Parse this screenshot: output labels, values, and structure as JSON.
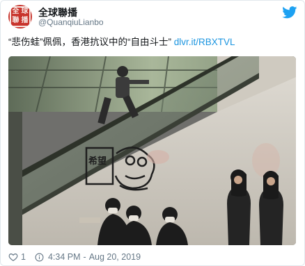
{
  "account": {
    "display_name": "全球聯播",
    "handle": "@QuanqiuLianbo",
    "avatar_seal": [
      "全",
      "球",
      "聯",
      "播"
    ]
  },
  "tweet": {
    "text": "“悲伤蛙”佩佩，香港抗议中的“自由斗士”",
    "link": "dlvr.it/RBXTVL"
  },
  "photo": {
    "sign_text": "希望",
    "description_icon": "photo"
  },
  "footer": {
    "likes": "1",
    "time": "4:34 PM",
    "separator": "-",
    "date": "Aug 20, 2019"
  },
  "colors": {
    "link": "#1b95e0",
    "twitter_blue": "#1da1f2",
    "muted": "#657786",
    "like_red": "#e0245e"
  },
  "icons": [
    "twitter-bird-icon",
    "heart-icon",
    "info-icon"
  ]
}
